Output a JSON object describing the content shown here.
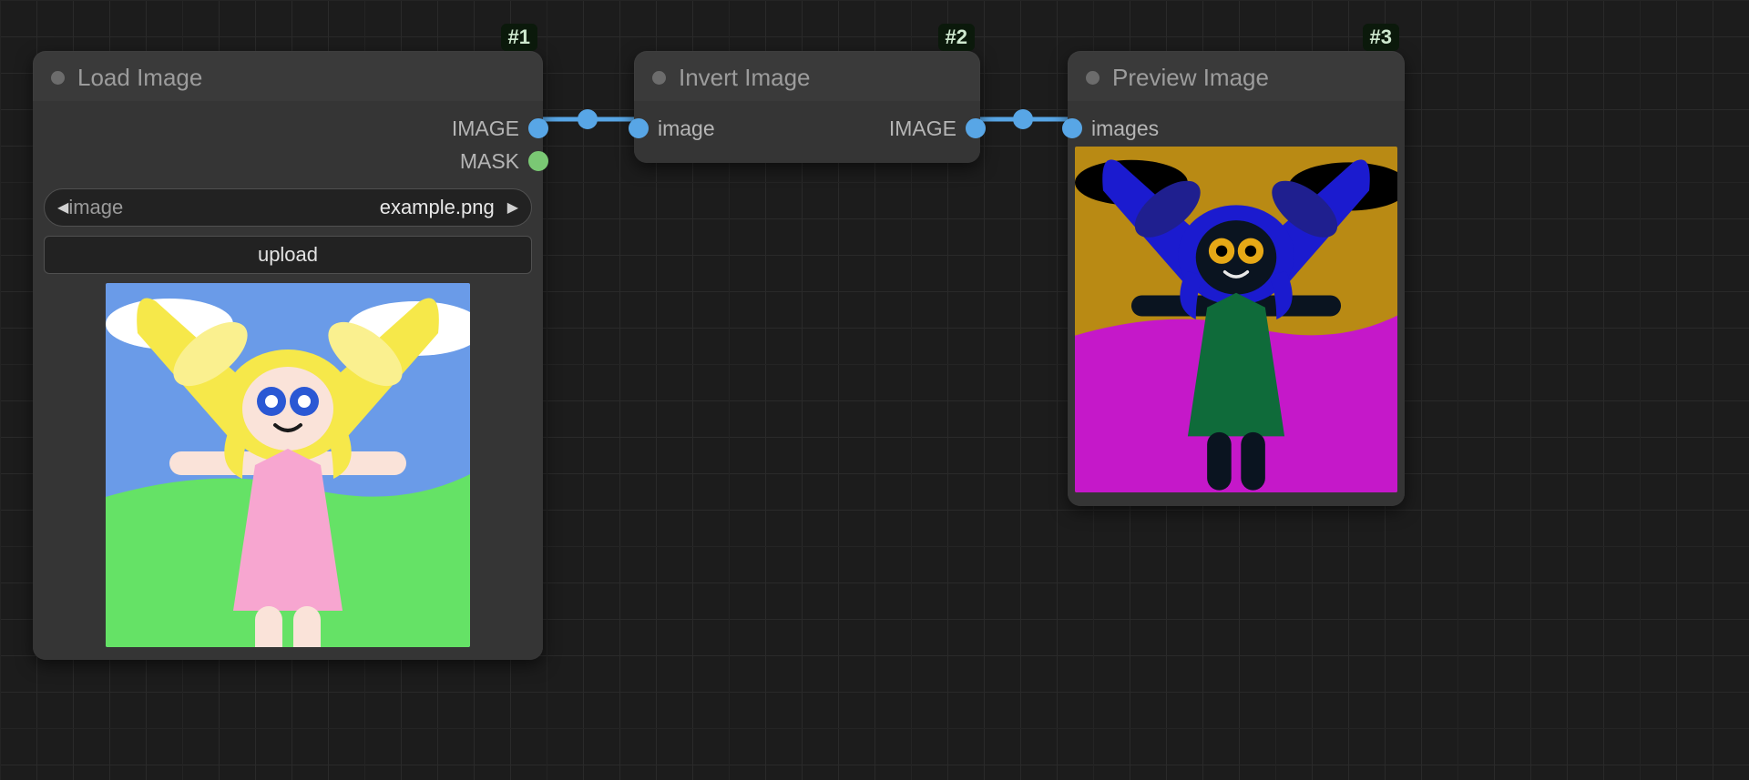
{
  "nodes": {
    "load": {
      "badge": "#1",
      "title": "Load Image",
      "outputs": {
        "image": "IMAGE",
        "mask": "MASK"
      },
      "widget_image": {
        "label": "image",
        "value": "example.png"
      },
      "upload_label": "upload"
    },
    "invert": {
      "badge": "#2",
      "title": "Invert Image",
      "inputs": {
        "image": "image"
      },
      "outputs": {
        "image": "IMAGE"
      }
    },
    "preview": {
      "badge": "#3",
      "title": "Preview Image",
      "inputs": {
        "images": "images"
      }
    }
  },
  "image_original": {
    "sky": "#6a9be8",
    "cloud": "#ffffff",
    "grass": "#65e266",
    "hair": "#f6e84a",
    "hair_inner": "#faf08f",
    "skin": "#fae3d9",
    "eye_outer": "#2a58d4",
    "eye_inner": "#ffffff",
    "mouth": "#1a1a1a",
    "dress": "#f7a6d0"
  },
  "image_inverted": {
    "sky": "#b98a14",
    "cloud": "#000000",
    "grass": "#c518c9",
    "hair": "#1b1bcf",
    "hair_inner": "#1f1f8f",
    "skin": "#0a1420",
    "eye_outer": "#e6a816",
    "eye_inner": "#000000",
    "mouth": "#e8e8e8",
    "dress": "#0f6b3a"
  }
}
